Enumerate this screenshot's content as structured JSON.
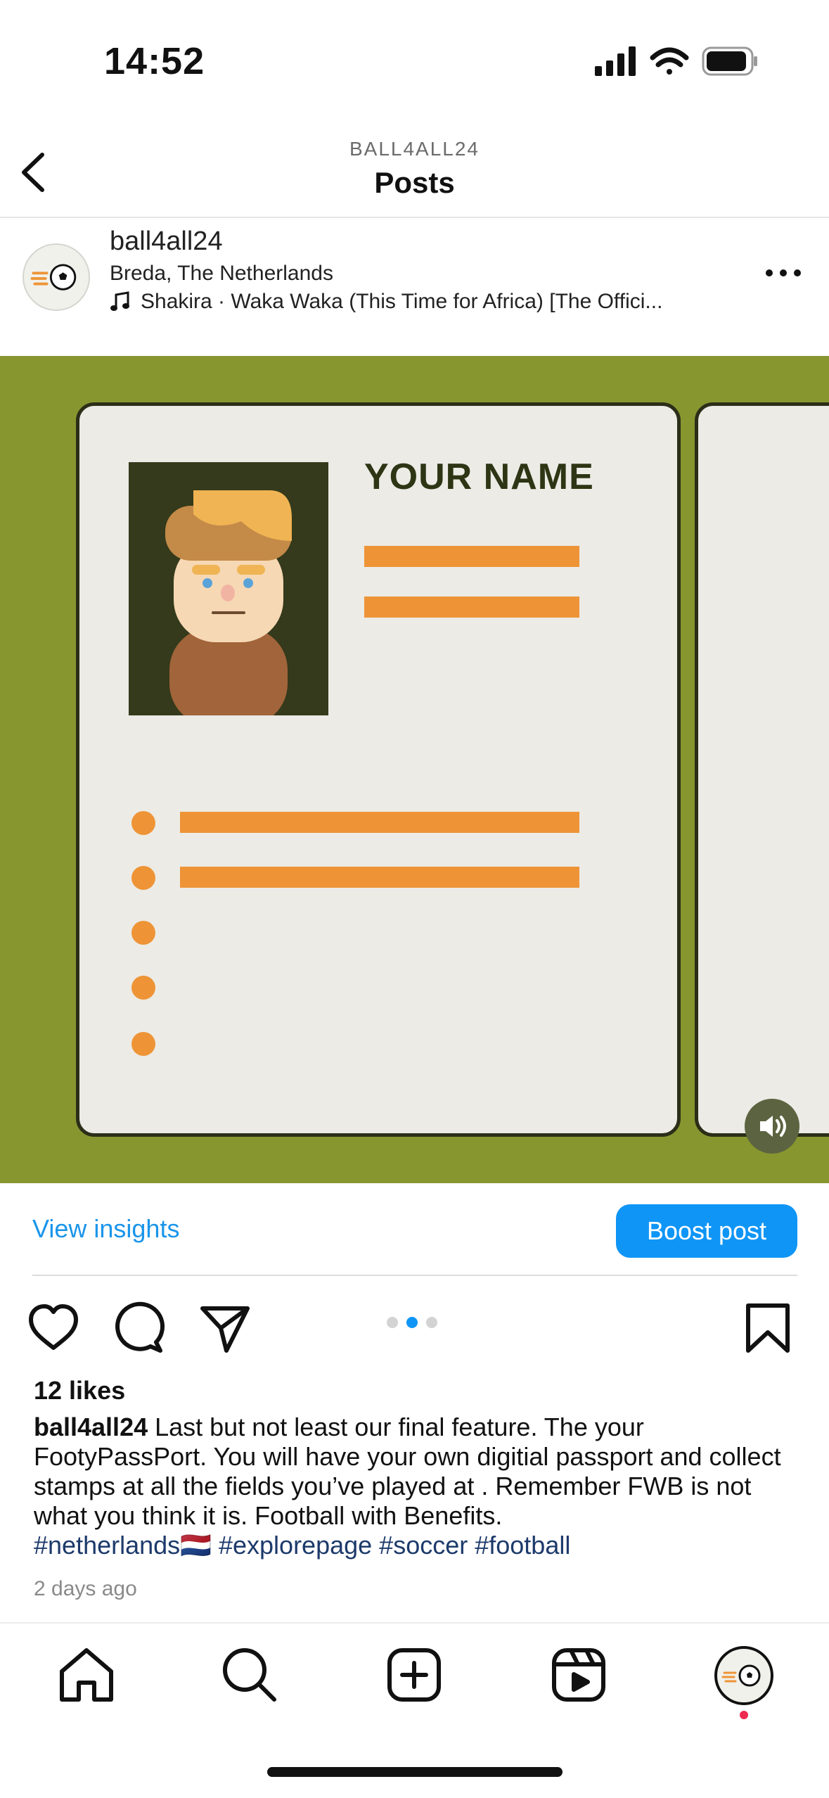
{
  "status_bar": {
    "time": "14:52"
  },
  "header": {
    "subtitle": "BALL4ALL24",
    "title": "Posts"
  },
  "post": {
    "username": "ball4all24",
    "location": "Breda, The Netherlands",
    "music": "Shakira · Waka Waka (This Time for Africa) [The Offici...",
    "card_name": "YOUR NAME",
    "insights_label": "View insights",
    "boost_label": "Boost post",
    "likes": "12 likes",
    "caption_text": " Last but not least our final feature. The your FootyPassPort. You will have your own digitial passport and collect stamps at all the fields you’ve played at . Remember FWB is not what you think it is. Football with Benefits.",
    "hashtags": "#netherlands🇳🇱 #explorepage #soccer #football",
    "timestamp": "2 days ago",
    "carousel": {
      "total": 3,
      "active": 2
    }
  },
  "colors": {
    "accent_blue": "#0f95f6",
    "media_bg": "#889630",
    "card_bg": "#ecebe6",
    "orange": "#ee9436",
    "dark_olive": "#2d3514"
  }
}
